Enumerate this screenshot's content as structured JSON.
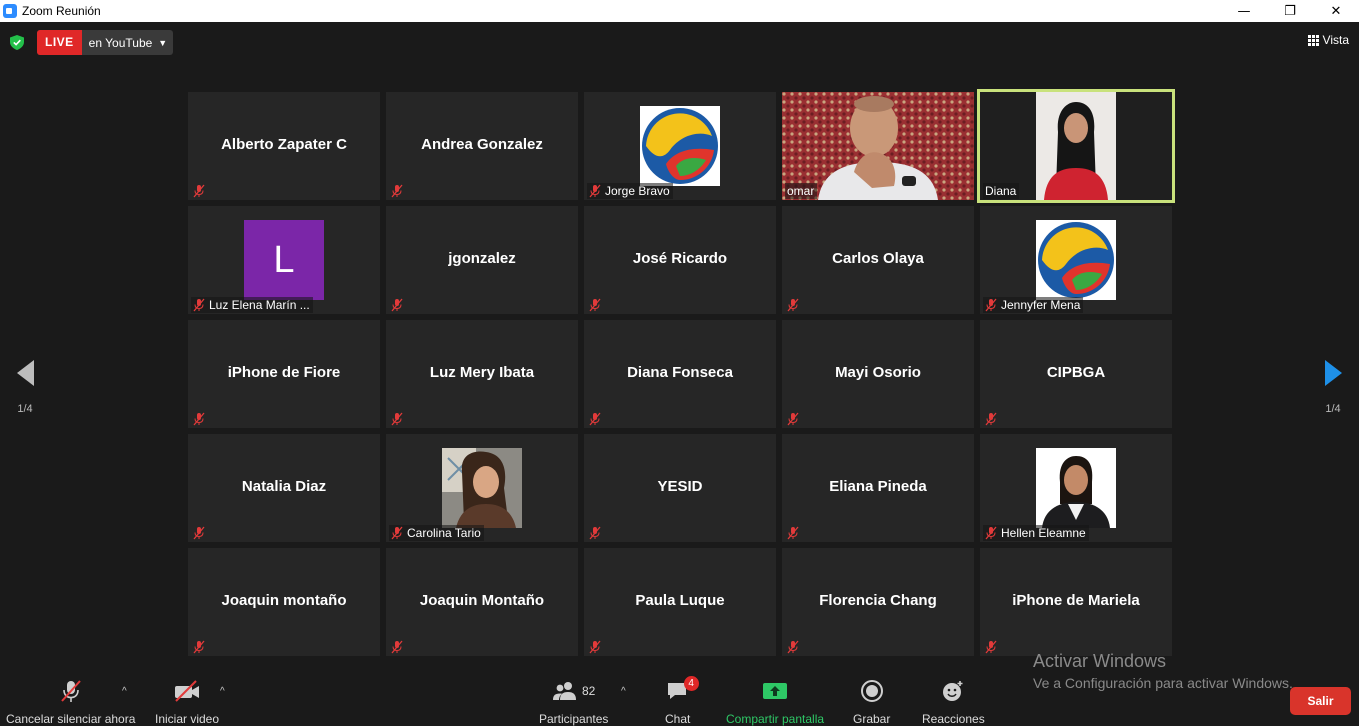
{
  "window": {
    "title": "Zoom Reunión"
  },
  "live": {
    "badge": "LIVE",
    "destination": "en YouTube"
  },
  "view_button": {
    "label": "Vista"
  },
  "paging": {
    "left_label": "1/4",
    "right_label": "1/4"
  },
  "participants": [
    {
      "name": "Alberto Zapater C",
      "tile": "name"
    },
    {
      "name": "Andrea Gonzalez",
      "tile": "name"
    },
    {
      "name": "Jorge Bravo",
      "tile": "logo"
    },
    {
      "name": "omar",
      "tile": "video-omar"
    },
    {
      "name": "Diana",
      "tile": "video-diana"
    },
    {
      "name": "Luz Elena Marín ...",
      "tile": "avatar",
      "avatar_letter": "L"
    },
    {
      "name": "jgonzalez",
      "tile": "name"
    },
    {
      "name": "José Ricardo",
      "tile": "name"
    },
    {
      "name": "Carlos Olaya",
      "tile": "name"
    },
    {
      "name": "Jennyfer Mena",
      "tile": "logo"
    },
    {
      "name": "iPhone de Fiore",
      "tile": "name"
    },
    {
      "name": "Luz Mery Ibata",
      "tile": "name"
    },
    {
      "name": "Diana Fonseca",
      "tile": "name"
    },
    {
      "name": "Mayi Osorio",
      "tile": "name"
    },
    {
      "name": "CIPBGA",
      "tile": "name"
    },
    {
      "name": "Natalia Diaz",
      "tile": "name"
    },
    {
      "name": "Carolina Tario",
      "tile": "photo-carolina"
    },
    {
      "name": "YESID",
      "tile": "name"
    },
    {
      "name": "Eliana Pineda",
      "tile": "name"
    },
    {
      "name": "Hellen Eleamne",
      "tile": "photo-hellen"
    },
    {
      "name": "Joaquin montaño",
      "tile": "name"
    },
    {
      "name": "Joaquin Montaño",
      "tile": "name"
    },
    {
      "name": "Paula Luque",
      "tile": "name"
    },
    {
      "name": "Florencia Chang",
      "tile": "name"
    },
    {
      "name": "iPhone de Mariela",
      "tile": "name"
    }
  ],
  "toolbar": {
    "mute": "Cancelar silenciar ahora",
    "video": "Iniciar video",
    "participants": "Participantes",
    "participants_count": "82",
    "chat": "Chat",
    "chat_badge": "4",
    "share": "Compartir pantalla",
    "record": "Grabar",
    "reactions": "Reacciones",
    "leave": "Salir"
  },
  "watermark": {
    "line1": "Activar Windows",
    "line2": "Ve a Configuración para activar Windows."
  },
  "colors": {
    "live_red": "#e02828",
    "active_speaker": "#c9e27c",
    "share_green": "#2ec866",
    "leave_red": "#d9342b",
    "next_arrow": "#1e90e8"
  }
}
